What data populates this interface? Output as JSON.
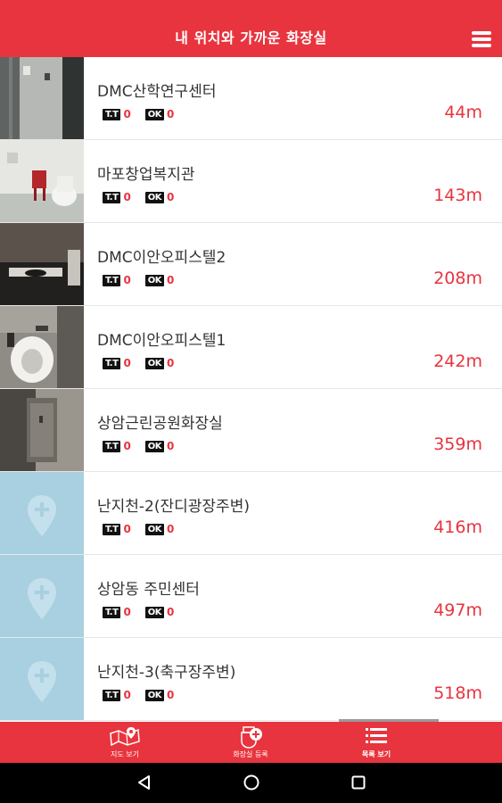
{
  "header": {
    "title": "내 위치와 가까운 화장실"
  },
  "places": [
    {
      "name": "DMC산학연구센터",
      "tt_badge": "T.T",
      "tt_count": "0",
      "ok_badge": "OK",
      "ok_count": "0",
      "distance": "44m",
      "has_photo": true
    },
    {
      "name": "마포창업복지관",
      "tt_badge": "T.T",
      "tt_count": "0",
      "ok_badge": "OK",
      "ok_count": "0",
      "distance": "143m",
      "has_photo": true
    },
    {
      "name": "DMC이안오피스텔2",
      "tt_badge": "T.T",
      "tt_count": "0",
      "ok_badge": "OK",
      "ok_count": "0",
      "distance": "208m",
      "has_photo": true
    },
    {
      "name": "DMC이안오피스텔1",
      "tt_badge": "T.T",
      "tt_count": "0",
      "ok_badge": "OK",
      "ok_count": "0",
      "distance": "242m",
      "has_photo": true
    },
    {
      "name": "상암근린공원화장실",
      "tt_badge": "T.T",
      "tt_count": "0",
      "ok_badge": "OK",
      "ok_count": "0",
      "distance": "359m",
      "has_photo": true
    },
    {
      "name": "난지천-2(잔디광장주변)",
      "tt_badge": "T.T",
      "tt_count": "0",
      "ok_badge": "OK",
      "ok_count": "0",
      "distance": "416m",
      "has_photo": false
    },
    {
      "name": "상암동 주민센터",
      "tt_badge": "T.T",
      "tt_count": "0",
      "ok_badge": "OK",
      "ok_count": "0",
      "distance": "497m",
      "has_photo": false
    },
    {
      "name": "난지천-3(축구장주변)",
      "tt_badge": "T.T",
      "tt_count": "0",
      "ok_badge": "OK",
      "ok_count": "0",
      "distance": "518m",
      "has_photo": false
    }
  ],
  "tabs": [
    {
      "label": "지도 보기",
      "icon": "map-icon"
    },
    {
      "label": "화장실 등록",
      "icon": "add-toilet-icon"
    },
    {
      "label": "목록 보기",
      "icon": "list-icon",
      "active": true
    }
  ],
  "colors": {
    "accent": "#e8343e",
    "placeholder": "#a8d0e0",
    "badge": "#111111"
  }
}
